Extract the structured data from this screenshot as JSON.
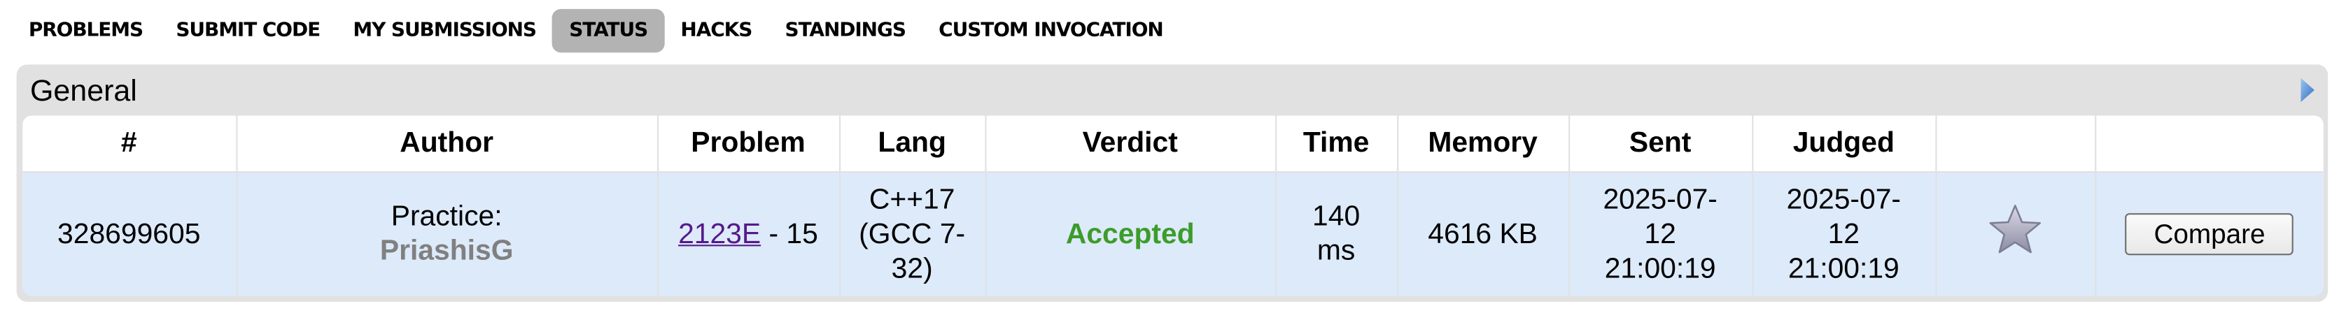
{
  "nav": [
    {
      "label": "PROBLEMS",
      "active": false
    },
    {
      "label": "SUBMIT CODE",
      "active": false
    },
    {
      "label": "MY SUBMISSIONS",
      "active": false
    },
    {
      "label": "STATUS",
      "active": true
    },
    {
      "label": "HACKS",
      "active": false
    },
    {
      "label": "STANDINGS",
      "active": false
    },
    {
      "label": "CUSTOM INVOCATION",
      "active": false
    }
  ],
  "panel": {
    "title": "General",
    "toggle_icon": "right-triangle-icon"
  },
  "columns": [
    "#",
    "Author",
    "Problem",
    "Lang",
    "Verdict",
    "Time",
    "Memory",
    "Sent",
    "Judged",
    "",
    ""
  ],
  "row": {
    "id": "328699605",
    "author_prefix": "Practice:",
    "author_name": "PriashisG",
    "problem_link": "2123E",
    "problem_suffix": " - 15",
    "lang_line1": "C++17",
    "lang_line2": "(GCC 7-",
    "lang_line3": "32)",
    "verdict": "Accepted",
    "time_line1": "140",
    "time_line2": "ms",
    "memory": "4616 KB",
    "sent_line1": "2025-07-",
    "sent_line2": "12",
    "sent_line3": "21:00:19",
    "judged_line1": "2025-07-",
    "judged_line2": "12",
    "judged_line3": "21:00:19",
    "favorite_icon": "star-icon",
    "compare_label": "Compare"
  },
  "colors": {
    "verdict_accepted": "#3c9c2a",
    "row_bg": "#ddeafa",
    "active_tab_bg": "#b3b3b3"
  }
}
